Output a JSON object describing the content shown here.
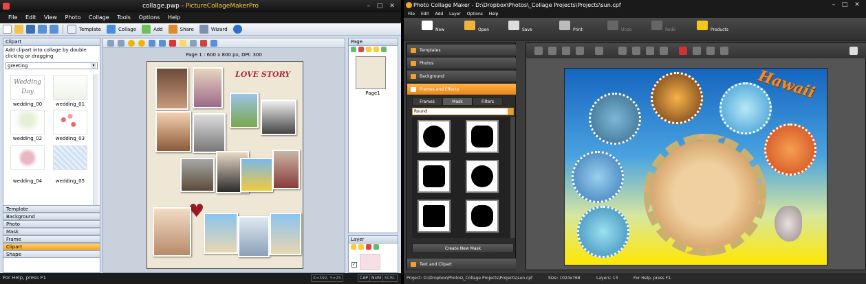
{
  "left_window": {
    "title_file": "collage.pwp",
    "title_sep": " - ",
    "title_app": "PictureCollageMakerPro",
    "menu": [
      "File",
      "Edit",
      "View",
      "Photo",
      "Collage",
      "Tools",
      "Options",
      "Help"
    ],
    "toolbar": {
      "template": "Template",
      "collage": "Collage",
      "add": "Add",
      "share": "Share",
      "wizard": "Wizard"
    },
    "clipart_panel": {
      "header": "Clipart",
      "description": "Add clipart into collage by double clicking or dragging",
      "category": "greeting",
      "items": [
        "wedding_00",
        "wedding_01",
        "wedding_02",
        "wedding_03",
        "wedding_04",
        "wedding_05"
      ],
      "wedding_text": "Wedding Day"
    },
    "accordion": [
      "Template",
      "Background",
      "Photo",
      "Mask",
      "Frame",
      "Clipart",
      "Shape"
    ],
    "page_info": "Page 1 : 600 x 800 px, DPI: 300",
    "canvas_title": "LOVE STORY",
    "page_panel": {
      "header": "Page",
      "page_label": "Page1"
    },
    "layer_panel": {
      "header": "Layer"
    },
    "status": {
      "help": "For Help, press F1",
      "caps": "CAP",
      "num": "NUM",
      "scrl": "SCRL",
      "coords": "X=392, Y=25"
    }
  },
  "right_window": {
    "title": "Photo Collage Maker - D:\\Dropbox\\Photos\\_Collage Projects\\Projects\\sun.cpf",
    "menu": [
      "File",
      "Edit",
      "Add",
      "Layer",
      "Options",
      "Help"
    ],
    "toolbar": [
      "New",
      "Open",
      "Save",
      "Print",
      "Undo",
      "Redo",
      "Products"
    ],
    "sections": [
      "Templates",
      "Photos",
      "Background",
      "Frames and Effects",
      "Text and Clipart"
    ],
    "subtabs": [
      "Frames",
      "Mask",
      "Filters"
    ],
    "mask_select": "Round",
    "create_mask": "Create New Mask",
    "canvas_text": "Hawaii",
    "status": {
      "project": "Project: D:\\Dropbox\\Photos\\_Collage Projects\\Projects\\sun.cpf",
      "size": "Size: 1024x768",
      "layers": "Layers: 13",
      "help": "For Help, press F1."
    }
  },
  "colors": {
    "accent_orange": "#f5a623",
    "dark_bg": "#1c1c1c",
    "panel_blue": "#d4dde9"
  }
}
